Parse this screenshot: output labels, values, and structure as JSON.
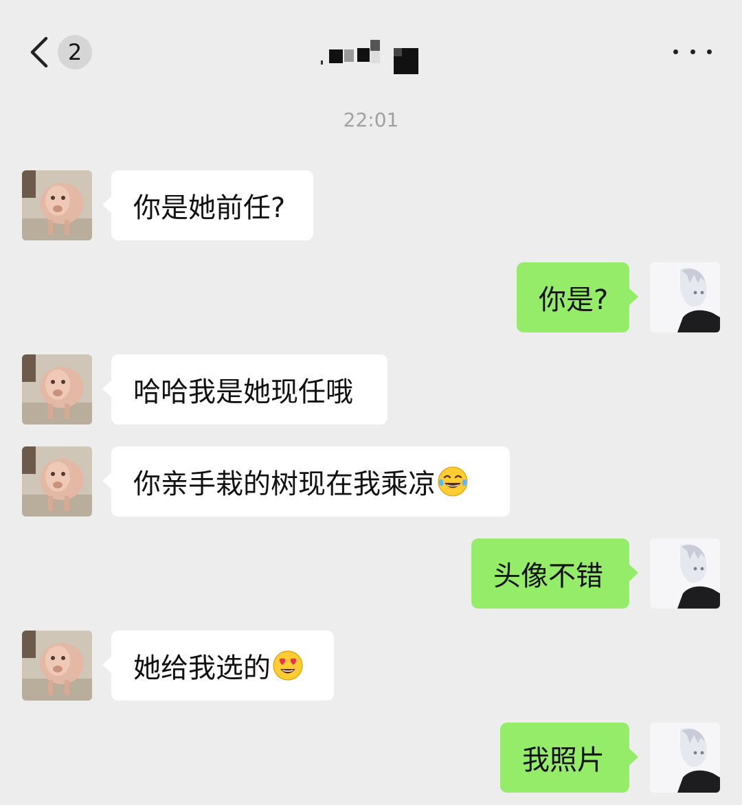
{
  "header": {
    "unread_count": "2",
    "contact_name": "",
    "back_icon": "chevron-left-icon",
    "more_icon": "more-dots-icon"
  },
  "timestamp": "22:01",
  "messages": [
    {
      "side": "in",
      "text": "你是她前任?"
    },
    {
      "side": "out",
      "text": "你是?"
    },
    {
      "side": "in",
      "text": "哈哈我是她现任哦"
    },
    {
      "side": "in",
      "text": "你亲手栽的树现在我乘凉",
      "emoji": "tears-of-joy-emoji"
    },
    {
      "side": "out",
      "text": "头像不错"
    },
    {
      "side": "in",
      "text": "她给我选的",
      "emoji": "heart-eyes-emoji"
    },
    {
      "side": "out",
      "text": "我照片"
    }
  ],
  "colors": {
    "background": "#ededed",
    "incoming_bubble": "#ffffff",
    "outgoing_bubble": "#95ec69",
    "timestamp": "#a0a0a0"
  }
}
